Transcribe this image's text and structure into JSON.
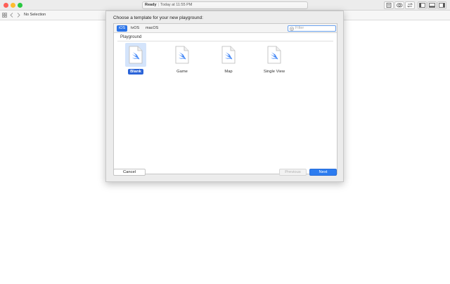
{
  "window": {
    "activity_status": "Ready",
    "activity_separator": "|",
    "activity_timestamp": "Today at 11:55 PM"
  },
  "navbar": {
    "selection_text": "No Selection"
  },
  "sheet": {
    "title": "Choose a template for your new playground:",
    "platforms": [
      {
        "label": "iOS",
        "selected": true
      },
      {
        "label": "tvOS",
        "selected": false
      },
      {
        "label": "macOS",
        "selected": false
      }
    ],
    "filter_placeholder": "Filter",
    "section": "Playground",
    "templates": [
      {
        "label": "Blank",
        "selected": true
      },
      {
        "label": "Game",
        "selected": false
      },
      {
        "label": "Map",
        "selected": false
      },
      {
        "label": "Single View",
        "selected": false
      }
    ],
    "buttons": {
      "cancel": "Cancel",
      "previous": "Previous",
      "next": "Next"
    }
  },
  "colors": {
    "accent": "#2a73e8",
    "selection_tile": "#d4e4fb",
    "swift_icon": "#3b82f6"
  }
}
